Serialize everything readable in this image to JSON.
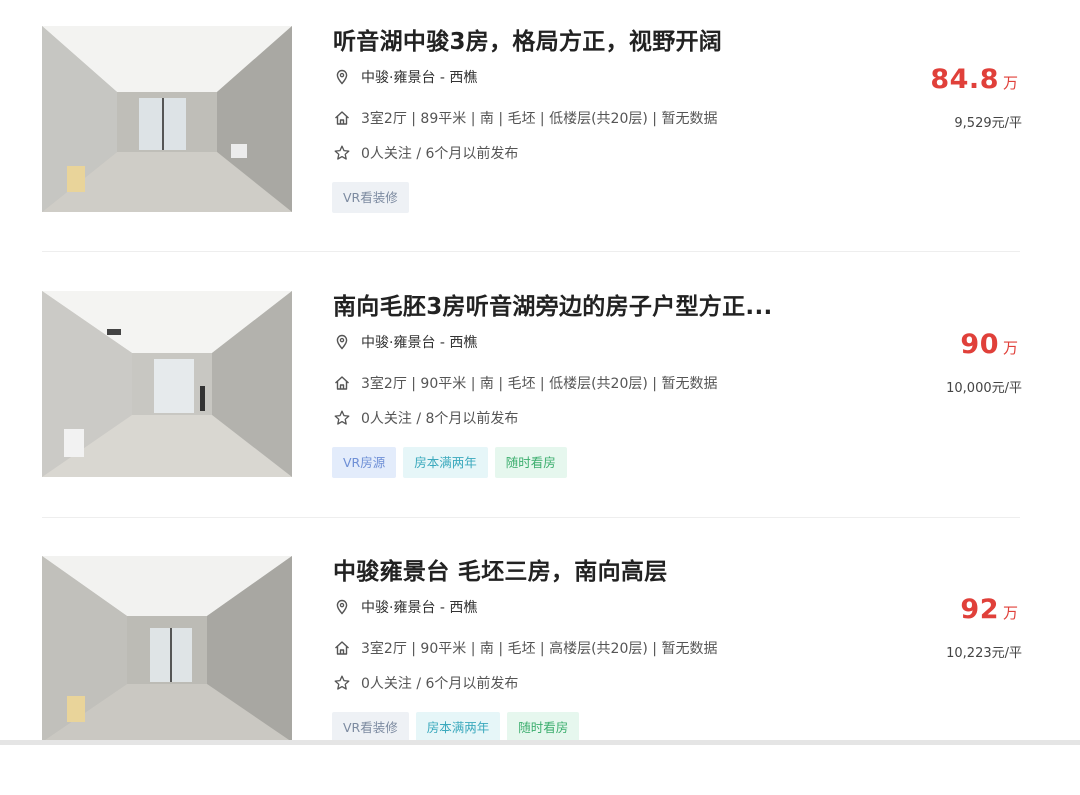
{
  "listings": [
    {
      "title": "听音湖中骏3房，格局方正，视野开阔",
      "location": "中骏·雍景台 - 西樵",
      "info": "3室2厅 | 89平米 | 南 | 毛坯 | 低楼层(共20层) | 暂无数据",
      "follow": "0人关注 / 6个月以前发布",
      "tags": [
        "VR看装修"
      ],
      "price": "84.8",
      "price_unit": "万",
      "unit_price": "9,529元/平"
    },
    {
      "title": "南向毛胚3房听音湖旁边的房子户型方正...",
      "location": "中骏·雍景台 - 西樵",
      "info": "3室2厅 | 90平米 | 南 | 毛坯 | 低楼层(共20层) | 暂无数据",
      "follow": "0人关注 / 8个月以前发布",
      "tags": [
        "VR房源",
        "房本满两年",
        "随时看房"
      ],
      "price": "90",
      "price_unit": "万",
      "unit_price": "10,000元/平"
    },
    {
      "title": "中骏雍景台 毛坯三房，南向高层",
      "location": "中骏·雍景台 - 西樵",
      "info": "3室2厅 | 90平米 | 南 | 毛坯 | 高楼层(共20层) | 暂无数据",
      "follow": "0人关注 / 6个月以前发布",
      "tags": [
        "VR看装修",
        "房本满两年",
        "随时看房"
      ],
      "price": "92",
      "price_unit": "万",
      "unit_price": "10,223元/平"
    }
  ],
  "icons": {
    "location": "location-pin-icon",
    "house": "house-icon",
    "follow": "star-icon"
  },
  "colors": {
    "price": "#e0403a",
    "tag_vr": "#7c8aa0",
    "tag_vr_blue": "#6e8fd6",
    "tag_cyan": "#3ba9bd",
    "tag_green": "#3cae6e"
  }
}
